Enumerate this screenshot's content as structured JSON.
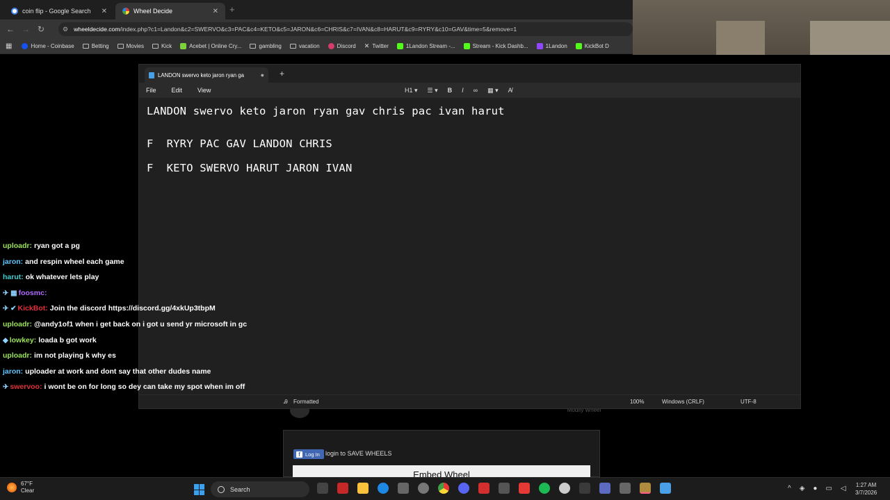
{
  "browser": {
    "tabs": [
      {
        "label": "coin flip - Google Search",
        "active": false
      },
      {
        "label": "Wheel Decide",
        "active": true
      }
    ],
    "new_tab": "+",
    "url_domain": "wheeldecide.com",
    "url_path": "/index.php?c1=Landon&c2=SWERVO&c3=PAC&c4=KETO&c5=JARON&c6=CHRIS&c7=IVAN&c8=HARUT&c9=RYRY&c10=GAV&time=5&remove=1",
    "bookmarks": [
      {
        "label": "Home - Coinbase",
        "icon": "coinbase-icon",
        "color": "#1652f0"
      },
      {
        "label": "Betting",
        "icon": "folder-icon"
      },
      {
        "label": "Movies",
        "icon": "folder-icon"
      },
      {
        "label": "Kick",
        "icon": "folder-icon"
      },
      {
        "label": "Acebet | Online Cry...",
        "icon": "acebet-icon",
        "color": "#7cd43a"
      },
      {
        "label": "gambling",
        "icon": "folder-icon"
      },
      {
        "label": "vacation",
        "icon": "folder-icon"
      },
      {
        "label": "Discord",
        "icon": "discord-icon",
        "color": "#d63c6b"
      },
      {
        "label": "Twitter",
        "icon": "x-icon",
        "color": "#ffffff"
      },
      {
        "label": "1Landon Stream -...",
        "icon": "kick-icon",
        "color": "#53fc18"
      },
      {
        "label": "Stream - Kick Dashb...",
        "icon": "kick-icon",
        "color": "#53fc18"
      },
      {
        "label": "1Landon",
        "icon": "twitch-icon",
        "color": "#9146ff"
      },
      {
        "label": "KickBot D",
        "icon": "kick-icon",
        "color": "#53fc18"
      }
    ]
  },
  "notepad": {
    "tab_title": "LANDON swervo keto jaron ryan gav chris pac ivan harut",
    "tab_title_visible": "LANDON swervo keto jaron ryan ga",
    "menu": [
      "File",
      "Edit",
      "View"
    ],
    "tools": {
      "heading": "H1",
      "bold": "B",
      "italic": "I"
    },
    "lines": [
      "LANDON swervo keto jaron ryan gav chris pac ivan harut",
      "",
      "F  RYRY PAC GAV LANDON CHRIS",
      "F  KETO SWERVO HARUT JARON IVAN"
    ],
    "status": {
      "format": "Formatted",
      "zoom": "100%",
      "line_ending": "Windows (CRLF)",
      "encoding": "UTF-8"
    }
  },
  "wheel_page": {
    "modify": "Modify Wheel",
    "login_button": "Log In",
    "save_text": "login to SAVE WHEELS",
    "embed": "Embed Wheel"
  },
  "chat": [
    {
      "user": "uploadr",
      "user_color": "#9be35a",
      "text": "ryan got a pg"
    },
    {
      "user": "jaron",
      "user_color": "#5cc8ff",
      "text": "and respin wheel each game"
    },
    {
      "user": "harut",
      "user_color": "#3ed0d0",
      "text": "ok whatever lets play"
    },
    {
      "user": "foosmc",
      "user_color": "#b06cff",
      "text": "",
      "badges": "✈ ▦"
    },
    {
      "user": "KickBot",
      "user_color": "#e0303a",
      "text": "Join the discord https://discord.gg/4xkUp3tbpM",
      "badges": "✈ ✔"
    },
    {
      "user": "uploadr",
      "user_color": "#9be35a",
      "text": "@andy1of1 when i get back on i got u send yr microsoft in gc"
    },
    {
      "user": "lowkey",
      "user_color": "#9be35a",
      "text": "loada b got work",
      "badges": "◆"
    },
    {
      "user": "uploadr",
      "user_color": "#9be35a",
      "text": "im not playing k why es"
    },
    {
      "user": "jaron",
      "user_color": "#5cc8ff",
      "text": "uploader at work and dont say that other dudes name"
    },
    {
      "user": "swervoo",
      "user_color": "#e0303a",
      "text": "i wont be on for long so dey can take my spot when im off",
      "badges": "✈"
    }
  ],
  "taskbar": {
    "weather_temp": "67°F",
    "weather_desc": "Clear",
    "search_placeholder": "Search",
    "time": "1:27 AM",
    "date": "3/7/2026"
  }
}
